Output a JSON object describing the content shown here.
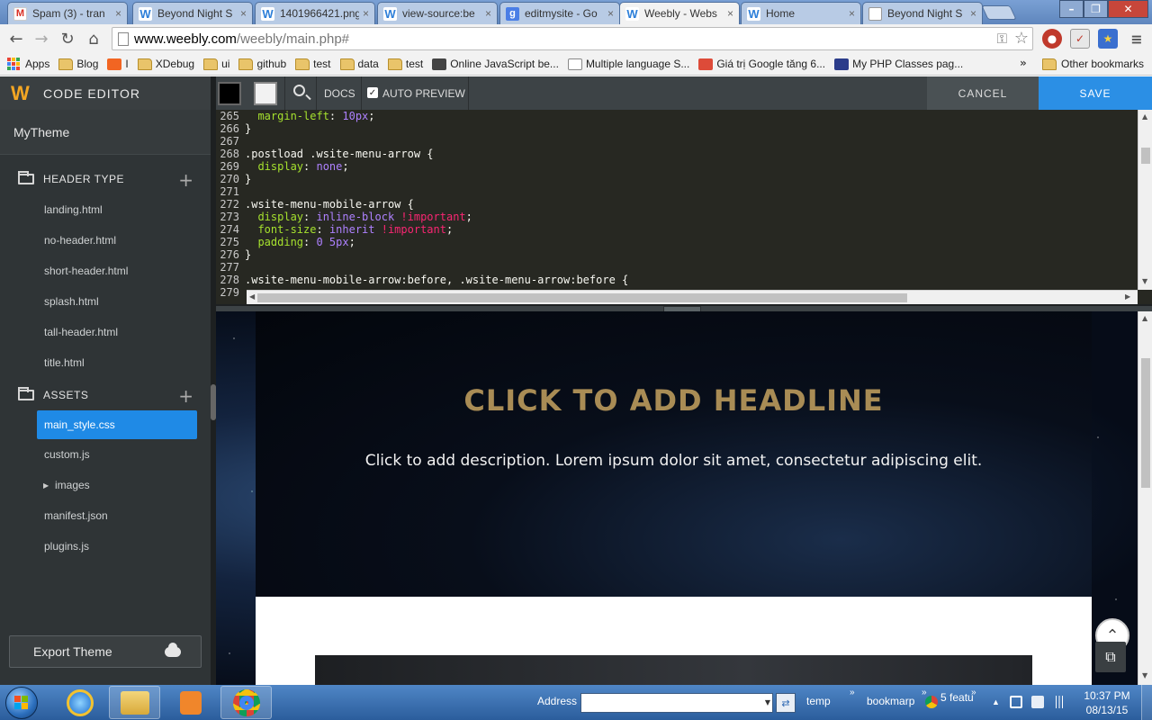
{
  "browser": {
    "tabs": [
      {
        "favicon": "gmail",
        "title": "Spam (3) - tran"
      },
      {
        "favicon": "weebly",
        "title": "Beyond Night S"
      },
      {
        "favicon": "weebly",
        "title": "1401966421.png"
      },
      {
        "favicon": "weebly",
        "title": "view-source:be"
      },
      {
        "favicon": "google",
        "title": "editmysite - Go"
      },
      {
        "favicon": "weebly",
        "title": "Weebly - Webs",
        "active": true
      },
      {
        "favicon": "weebly",
        "title": "Home"
      },
      {
        "favicon": "doc",
        "title": "Beyond Night S"
      }
    ],
    "tab_close_glyph": "×",
    "url_host": "www.weebly.com",
    "url_path": "/weebly/main.php#",
    "bookmarks": [
      {
        "icon": "apps",
        "label": "Apps"
      },
      {
        "icon": "folder",
        "label": "Blog"
      },
      {
        "icon": "rss",
        "label": "I"
      },
      {
        "icon": "folder",
        "label": "XDebug"
      },
      {
        "icon": "folder",
        "label": "ui"
      },
      {
        "icon": "folder",
        "label": "github"
      },
      {
        "icon": "folder",
        "label": "test"
      },
      {
        "icon": "folder",
        "label": "data"
      },
      {
        "icon": "folder",
        "label": "test"
      },
      {
        "icon": "owl",
        "label": "Online JavaScript be..."
      },
      {
        "icon": "page",
        "label": "Multiple language S..."
      },
      {
        "icon": "gplus",
        "label": "Giá trị Google tăng 6..."
      },
      {
        "icon": "php",
        "label": "My PHP Classes pag..."
      }
    ],
    "bookmarks_more": "»",
    "other_bookmarks": "Other bookmarks"
  },
  "editor": {
    "title": "CODE EDITOR",
    "theme_name": "MyTheme",
    "sections": [
      {
        "label": "HEADER TYPE",
        "files": [
          "landing.html",
          "no-header.html",
          "short-header.html",
          "splash.html",
          "tall-header.html",
          "title.html"
        ]
      },
      {
        "label": "ASSETS",
        "files": [
          "main_style.css",
          "custom.js",
          "images",
          "manifest.json",
          "plugins.js"
        ]
      }
    ],
    "active_file": "main_style.css",
    "export_label": "Export Theme",
    "toolbar": {
      "docs": "DOCS",
      "auto_preview": "AUTO PREVIEW",
      "auto_preview_checked": true,
      "cancel": "CANCEL",
      "save": "SAVE"
    },
    "code_lines": [
      {
        "n": "265",
        "tokens": [
          [
            "prop",
            "  margin-left"
          ],
          [
            "plain",
            ": "
          ],
          [
            "val",
            "10px"
          ],
          [
            "plain",
            ";"
          ]
        ]
      },
      {
        "n": "266",
        "tokens": [
          [
            "plain",
            "}"
          ]
        ]
      },
      {
        "n": "267",
        "tokens": []
      },
      {
        "n": "268",
        "tokens": [
          [
            "plain",
            ".postload .wsite-menu-arrow {"
          ]
        ]
      },
      {
        "n": "269",
        "tokens": [
          [
            "prop",
            "  display"
          ],
          [
            "plain",
            ": "
          ],
          [
            "val",
            "none"
          ],
          [
            "plain",
            ";"
          ]
        ]
      },
      {
        "n": "270",
        "tokens": [
          [
            "plain",
            "}"
          ]
        ]
      },
      {
        "n": "271",
        "tokens": []
      },
      {
        "n": "272",
        "tokens": [
          [
            "plain",
            ".wsite-menu-mobile-arrow {"
          ]
        ]
      },
      {
        "n": "273",
        "tokens": [
          [
            "prop",
            "  display"
          ],
          [
            "plain",
            ": "
          ],
          [
            "val",
            "inline-block "
          ],
          [
            "imp",
            "!important"
          ],
          [
            "plain",
            ";"
          ]
        ]
      },
      {
        "n": "274",
        "tokens": [
          [
            "prop",
            "  font-size"
          ],
          [
            "plain",
            ": "
          ],
          [
            "val",
            "inherit "
          ],
          [
            "imp",
            "!important"
          ],
          [
            "plain",
            ";"
          ]
        ]
      },
      {
        "n": "275",
        "tokens": [
          [
            "prop",
            "  padding"
          ],
          [
            "plain",
            ": "
          ],
          [
            "val",
            "0 5px"
          ],
          [
            "plain",
            ";"
          ]
        ]
      },
      {
        "n": "276",
        "tokens": [
          [
            "plain",
            "}"
          ]
        ]
      },
      {
        "n": "277",
        "tokens": []
      },
      {
        "n": "278",
        "tokens": [
          [
            "plain",
            ".wsite-menu-mobile-arrow:before, .wsite-menu-arrow:before {"
          ]
        ]
      },
      {
        "n": "279",
        "tokens": []
      }
    ]
  },
  "preview": {
    "headline": "CLICK TO ADD HEADLINE",
    "description": "Click to add description. Lorem ipsum dolor sit amet, consectetur adipiscing elit."
  },
  "taskbar": {
    "address_label": "Address",
    "tray_temp": "temp",
    "tray_bookmarp": "bookmarp",
    "tray_feature": "5 featu",
    "chevron": "»",
    "time": "10:37 PM",
    "date": "08/13/15"
  },
  "colors": {
    "accent": "#2b8fe5",
    "headline": "#a98c55",
    "logo": "#f4a623"
  }
}
